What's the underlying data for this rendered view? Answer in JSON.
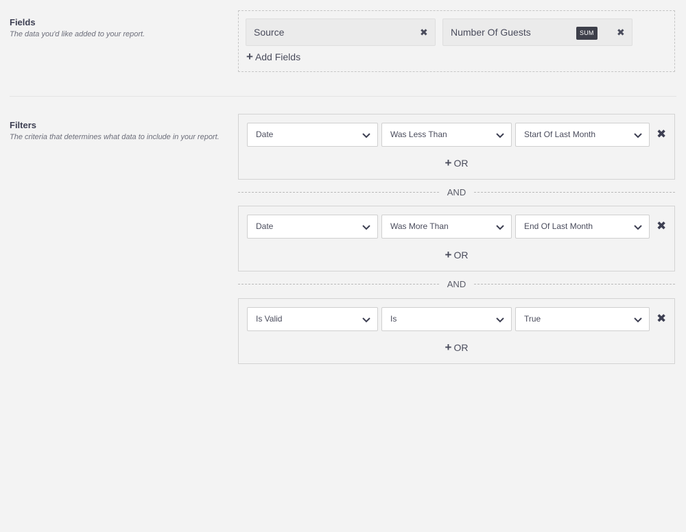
{
  "fields": {
    "title": "Fields",
    "description": "The data you'd like added to your report.",
    "chips": [
      {
        "label": "Source"
      },
      {
        "label": "Number Of Guests",
        "badge": "SUM"
      }
    ],
    "add_label": "Add Fields"
  },
  "filters": {
    "title": "Filters",
    "description": "The criteria that determines what data to include in your report.",
    "or_label": "OR",
    "and_label": "AND",
    "groups": [
      {
        "field": "Date",
        "operator": "Was Less Than",
        "value": "Start Of Last Month"
      },
      {
        "field": "Date",
        "operator": "Was More Than",
        "value": "End Of Last Month"
      },
      {
        "field": "Is Valid",
        "operator": "Is",
        "value": "True"
      }
    ]
  },
  "icons": {
    "remove": "close-icon",
    "select_caret": "chevron-down-icon",
    "add": "plus-icon"
  },
  "colors": {
    "background": "#f3f3f3",
    "text": "#3d3f52",
    "badge": "#3d3f4a"
  }
}
